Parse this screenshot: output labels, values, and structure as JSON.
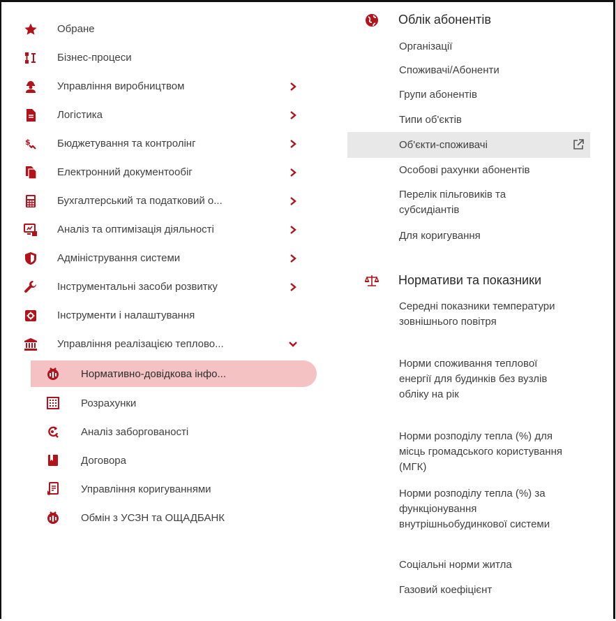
{
  "left_menu": {
    "items": [
      {
        "label": "Обране",
        "icon": "star-icon"
      },
      {
        "label": "Бізнес-процеси",
        "icon": "process-icon"
      },
      {
        "label": "Управління виробництвом",
        "icon": "worker-icon"
      },
      {
        "label": "Логістика",
        "icon": "document-icon"
      },
      {
        "label": "Бюджетування та контролінг",
        "icon": "budget-icon"
      },
      {
        "label": "Електронний документообіг",
        "icon": "documents-icon"
      },
      {
        "label": "Бухгалтерський та податковий о...",
        "icon": "calculator-icon"
      },
      {
        "label": "Аналіз та оптимізація діяльності",
        "icon": "analytics-icon"
      },
      {
        "label": "Адміністрування системи",
        "icon": "shield-icon"
      },
      {
        "label": "Інструментальні засоби розвитку",
        "icon": "wrench-icon"
      },
      {
        "label": "Інструменти і налаштування",
        "icon": "gear-icon"
      },
      {
        "label": "Управління реалізацією теплово...",
        "icon": "bank-icon"
      }
    ],
    "sub_items": [
      {
        "label": "Нормативно-довідкова інфо...",
        "icon": "reference-icon"
      },
      {
        "label": "Розрахунки",
        "icon": "abacus-icon"
      },
      {
        "label": "Аналіз заборгованості",
        "icon": "refresh-search-icon"
      },
      {
        "label": "Договора",
        "icon": "book-icon"
      },
      {
        "label": "Управління коригуваннями",
        "icon": "edit-document-icon"
      },
      {
        "label": "Обмін з УСЗН та ОЩАДБАНК",
        "icon": "exchange-icon"
      }
    ]
  },
  "right_panel": {
    "section1": {
      "title": "Облік абонентів",
      "icon": "globe-icon",
      "links": [
        "Організації",
        "Споживачі/Абоненти",
        "Групи абонентів",
        "Типи об'єктів",
        "Об'єкти-споживачі",
        "Особові рахунки абонентів",
        "Перелік пільговиків та субсидіантів",
        "Для коригування"
      ]
    },
    "section2": {
      "title": "Нормативи та показники",
      "icon": "scales-icon",
      "links": [
        "Середні показники температури зовнішнього повітря",
        "Норми споживання теплової енергії для будинків без вузлів обліку на рік",
        "Норми розподілу тепла (%) для місць громадського користування (МГК)",
        "Норми розподілу тепла (%) за функціонування внутрішньобудинкової системи",
        "Соціальні норми житла",
        "Газовий коефіцієнт"
      ]
    }
  },
  "colors": {
    "accent": "#b3121b",
    "active_bg": "#f5c2c4",
    "hover_bg": "#e8e8e8"
  }
}
